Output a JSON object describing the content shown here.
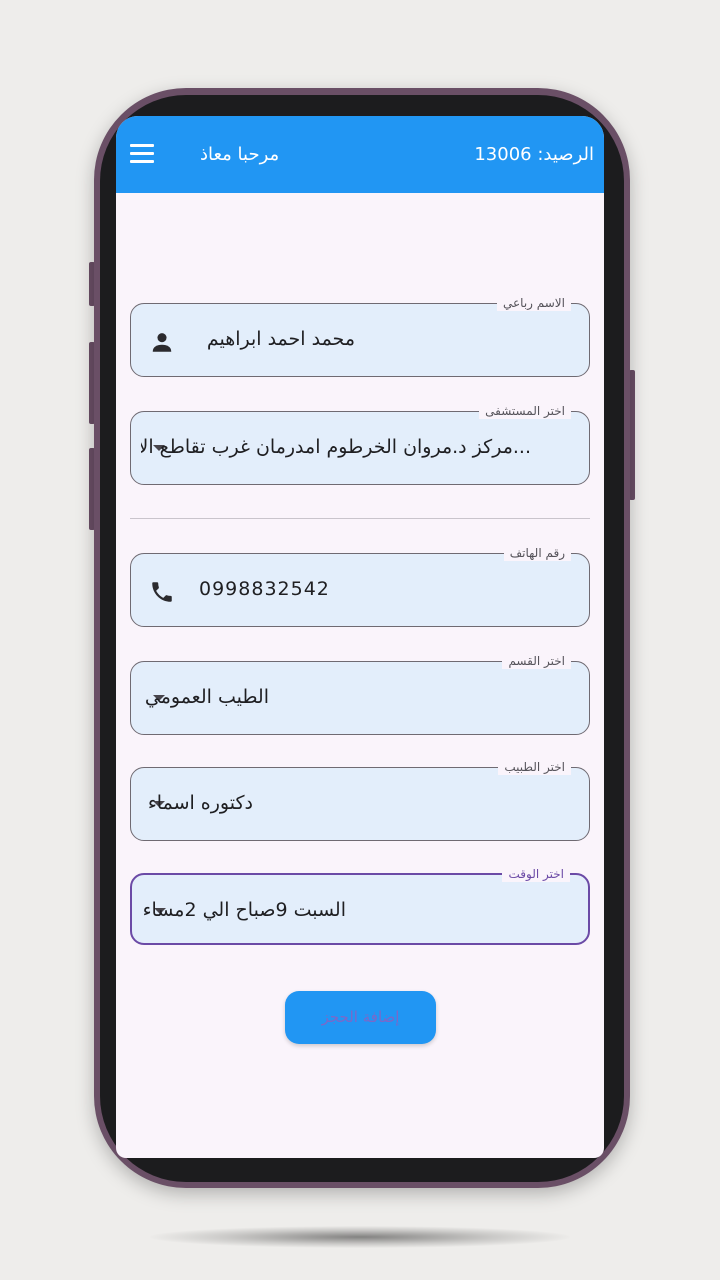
{
  "appbar": {
    "greeting": "مرحبا معاذ",
    "balance": "الرصيد: 13006",
    "menu_icon": "menu-icon"
  },
  "form": {
    "name": {
      "label": "الاسم رباعي",
      "value": "محمد احمد ابراهيم",
      "icon": "person-icon"
    },
    "hospital": {
      "label": "اختر المستشفى",
      "value": "...مركز د.مروان الخرطوم امدرمان غرب تقاطع الاب"
    },
    "phone": {
      "label": "رقم الهاتف",
      "value": "0998832542",
      "icon": "phone-icon"
    },
    "department": {
      "label": "اختر القسم",
      "value": "الطيب العمومي"
    },
    "doctor": {
      "label": "اختر الطبيب",
      "value": "دكتوره اسماء"
    },
    "time": {
      "label": "اختر الوقت",
      "value": "السبت 9صباح الي 2مساء"
    }
  },
  "submit_label": "إضافة الحجز",
  "colors": {
    "appbar": "#2196f3",
    "field_fill": "#e3eefb",
    "focus_border": "#6b4aa6",
    "screen_bg": "#faf4fb",
    "phone_frame": "#6a4f66"
  }
}
